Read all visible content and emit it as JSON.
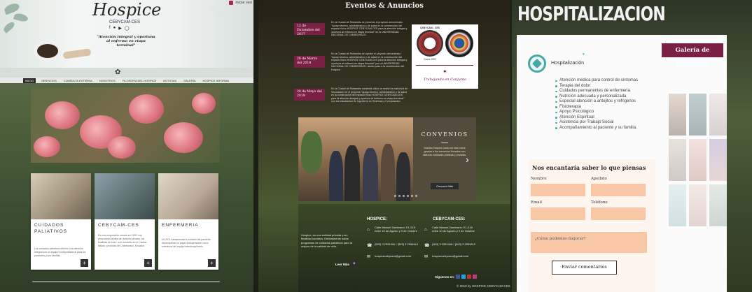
{
  "panel_a": {
    "brand": "Hospice",
    "subtitle": "CEBYCAM-CES",
    "tagline": "\"Atención integral y oportuna al enfermo en etapa terminal\"",
    "login": "Iniciar sesi",
    "social_icons": [
      "facebook-icon",
      "twitter-icon",
      "youtube-icon",
      "instagram-icon"
    ],
    "nav": [
      "INICIO",
      "SERVICIOS",
      "CONSULTA EXTERNA",
      "NOSOTROS",
      "FILOSOFÍA DEL HOSPICE",
      "NOTICIAS",
      "GALERÍA",
      "HOSPICE INFORMA"
    ],
    "cards": [
      {
        "title": "CUIDADOS PALIATIVOS",
        "text": "Los cuidados paliativos ofrecen una atención integral con un equipo multiprofesional para los pacientes y sus familias."
      },
      {
        "title": "CEBYCAM-CES",
        "text": "Es una corporación creada en 1993, con personería jurídica de derecho privado, sin finalidad de lucro, con domicilio en el Cantón Nabón, provincia de Chimborazo, Ecuador."
      },
      {
        "title": "ENFERMERIA",
        "text": "Un ROL fundamental el cuidado del paciente, desempeñan un papel indispensable como miembros del equipo interdisciplinario."
      }
    ]
  },
  "panel_b": {
    "title": "Eventos & Anuncios",
    "events": [
      {
        "date": "12 de Diciembre del 2017",
        "text": "En la Ciudad de Riobamba se presentó el proyecto denominado \"Apoyo técnico, administrativo y de salud en la construcción del espacio físico HOSPICE CEBYCAM-CES para la atención integral y oportuna al enfermo en etapa terminal\" en la UNIVERSIDAD NACIONAL DE CHIMBORAZO."
      },
      {
        "date": "28 de Marzo del 2018",
        "text": "En la Ciudad de Riobamba se aprobó el proyecto denominado \"Apoyo técnico, administrativo y de salud en la construcción del espacio físico HOSPICE CEBYCAM-CES para la atención integral y oportuna al enfermo en etapa terminal\" por la UNIVERSIDAD NACIONAL DE CHIMBORAZO, dando paso a la construcción del Hospice."
      },
      {
        "date": "20 de Mayo del 2019",
        "text": "En la Ciudad de Riobamba mediante oficio se realizó la matrícula de Vinculación en el proyecto \"Apoyo técnico, administrativo y de salud en la construcción del espacio físico HOSPICE CEBYCAM-CES para la atención integral y oportuna al enfermo en etapa terminal\" con los estudiantes de Ingeniería en Sistemas y Computación."
      }
    ],
    "logos_caption": "Trabajando en Conjunto",
    "logo_left_label": "CEBYCAM - CES",
    "logo_left_year": "Desde 1993",
    "slide": {
      "title": "CONVENIOS",
      "text": "Nuestro Hospice cada vez más crece gracias a los convenios firmados con distintas entidades públicas y privadas.",
      "button": "Conocer Más"
    },
    "footer": {
      "about": "Hospice, es una entidad privada y sin finalidad lucrativa. Debidamente sobre programas de cuidados paliativos para la mejora de la calidad de vida.",
      "read_more": "Leer Más",
      "hospice": {
        "heading": "HOSPICE:",
        "address": "Calle Manuel Zambrano: E1-218 entre 10 de Agosto y 9 de Octubre",
        "phones": "(593) 3 2951406 / (593) 3 2954810",
        "email": "hospicecebycam@gmail.com"
      },
      "cebycam": {
        "heading": "CEBYCAM-CES:",
        "address": "Calle Manuel Zambrano: E1-218 entre 10 de Agosto y 9 de Octubre",
        "phones": "(593) 3 2951406 / (593) 3 2954810",
        "email": "hospicecebycam@gmail.com"
      },
      "follow": "Síguenos en:",
      "copyright": "© 2019 by HOSPICE-CEBYCAM-CES"
    }
  },
  "panel_c": {
    "title": "HOSPITALIZACION",
    "section_label": "Hospitalización",
    "services": [
      "Atención médica para control de síntomas",
      "Terapia del dolor",
      "Cuidados permanentes de enfermería",
      "Nutrición adecuada y personalizada",
      "Especial atención a antojitos y refrigerios",
      "Fisioterapia",
      "Apoyo Psicológico",
      "Atención Espiritual",
      "Asistencia por Trabajo Social",
      "Acompañamiento al paciente y su familia."
    ],
    "gallery_title": "Galería de Imágenes",
    "form": {
      "title": "Nos encantaría saber lo que piensas",
      "name_label": "Nombre",
      "last_label": "Apellido",
      "email_label": "Email",
      "phone_label": "Teléfono",
      "message_placeholder": "¿Cómo podemos mejorar?",
      "send_button": "Enviar comentarios"
    }
  },
  "colors": {
    "accent": "#7b2044",
    "teal": "#4aa7a7",
    "field": "#f8c8a6"
  }
}
